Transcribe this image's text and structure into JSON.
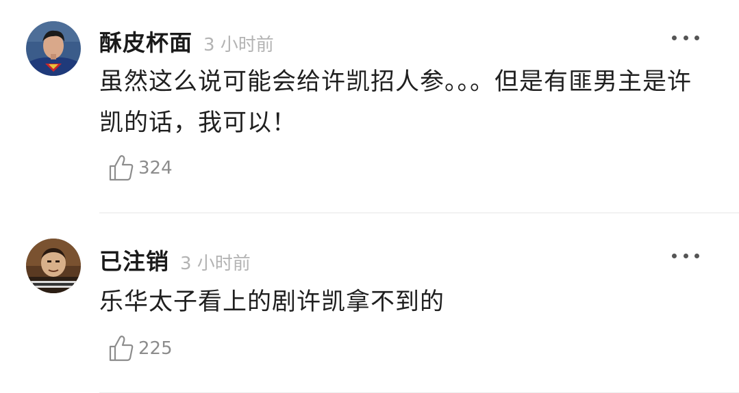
{
  "comments": [
    {
      "username": "酥皮杯面",
      "time": "3 小时前",
      "text": "虽然这么说可能会给许凯招人参。。。但是有匪男主是许凯的话，我可以！",
      "likes": "324",
      "avatar_icon": "superman-photo"
    },
    {
      "username": "已注销",
      "time": "3 小时前",
      "text": "乐华太子看上的剧许凯拿不到的",
      "likes": "225",
      "avatar_icon": "meme-photo"
    }
  ],
  "icons": {
    "more": "more-dots-icon",
    "like": "thumbs-up-icon"
  },
  "colors": {
    "username": "#1a1a1a",
    "time": "#b3b3b3",
    "like_count": "#8c8c8c",
    "divider": "#e6e6e6"
  }
}
